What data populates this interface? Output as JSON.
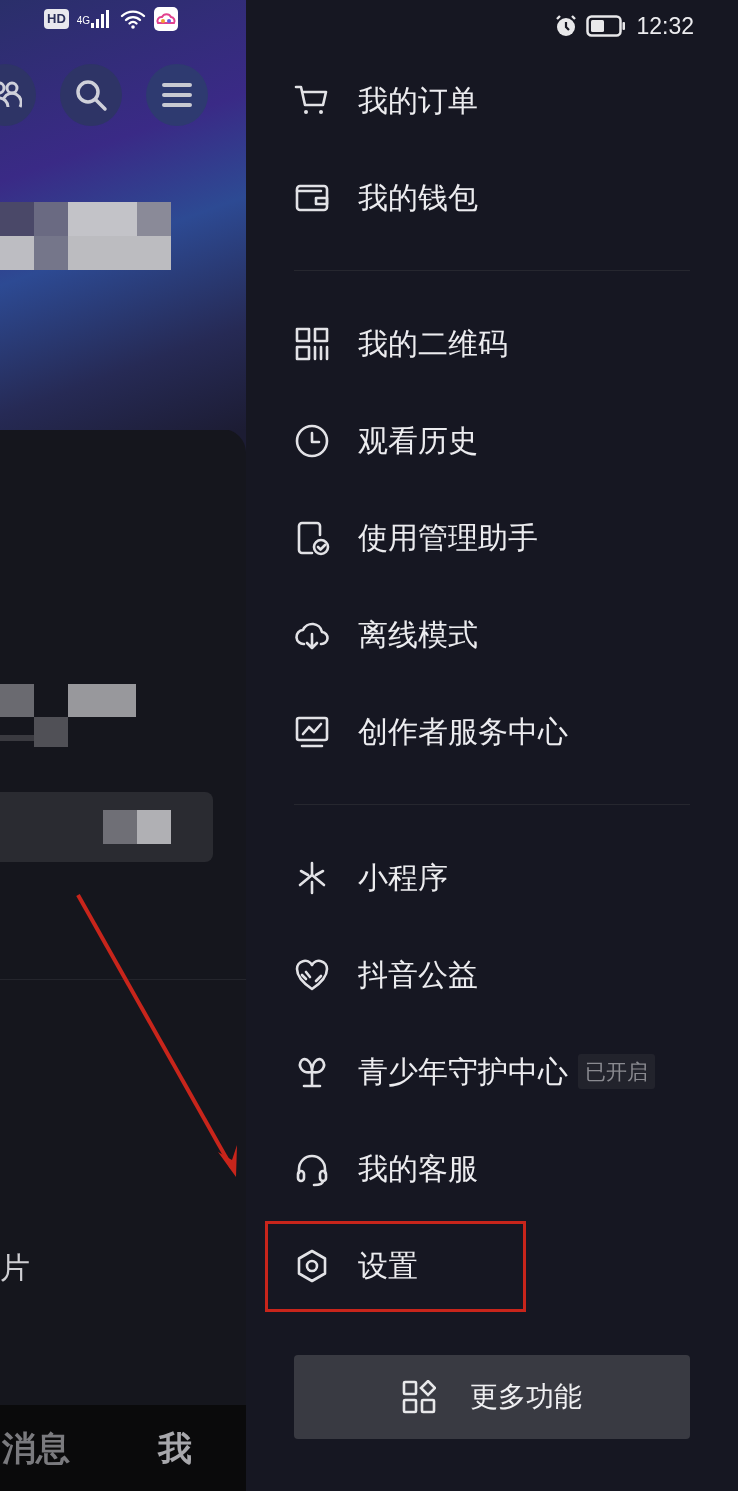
{
  "status_bar": {
    "network_badge": "HD",
    "network_type": "4G",
    "time": "12:32"
  },
  "background_page": {
    "partial_text": "片",
    "bottom_tabs": [
      {
        "label": "消息",
        "selected": false
      },
      {
        "label": "我",
        "selected": true
      }
    ]
  },
  "drawer": {
    "sections": [
      {
        "items": [
          {
            "label": "我的订单",
            "highlighted": false
          },
          {
            "label": "我的钱包",
            "highlighted": false
          }
        ]
      },
      {
        "items": [
          {
            "label": "我的二维码",
            "highlighted": false
          },
          {
            "label": "观看历史",
            "highlighted": false
          },
          {
            "label": "使用管理助手",
            "highlighted": false
          },
          {
            "label": "离线模式",
            "highlighted": false
          },
          {
            "label": "创作者服务中心",
            "highlighted": false
          }
        ]
      },
      {
        "items": [
          {
            "label": "小程序",
            "highlighted": false
          },
          {
            "label": "抖音公益",
            "highlighted": false
          },
          {
            "label": "青少年守护中心",
            "badge": "已开启",
            "highlighted": false
          },
          {
            "label": "我的客服",
            "highlighted": false
          },
          {
            "label": "设置",
            "highlighted": true
          }
        ]
      }
    ],
    "more_button": "更多功能"
  }
}
